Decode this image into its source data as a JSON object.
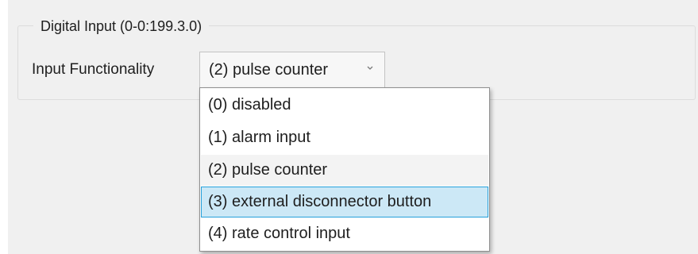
{
  "group": {
    "title": "Digital Input (0-0:199.3.0)"
  },
  "field": {
    "label": "Input Functionality",
    "selected_value": "(2) pulse counter",
    "arrow_icon": "chevron-down-icon"
  },
  "dropdown": {
    "options": [
      {
        "label": "(0) disabled"
      },
      {
        "label": "(1) alarm input"
      },
      {
        "label": "(2) pulse counter",
        "state": "selected"
      },
      {
        "label": "(3) external disconnector button",
        "state": "hovered"
      },
      {
        "label": "(4) rate control input"
      }
    ]
  },
  "colors": {
    "panel_background": "#f0f0f0",
    "hover_highlight": "#cce8f6",
    "hover_border": "#26a0da",
    "selected_background": "#f3f3f3"
  }
}
